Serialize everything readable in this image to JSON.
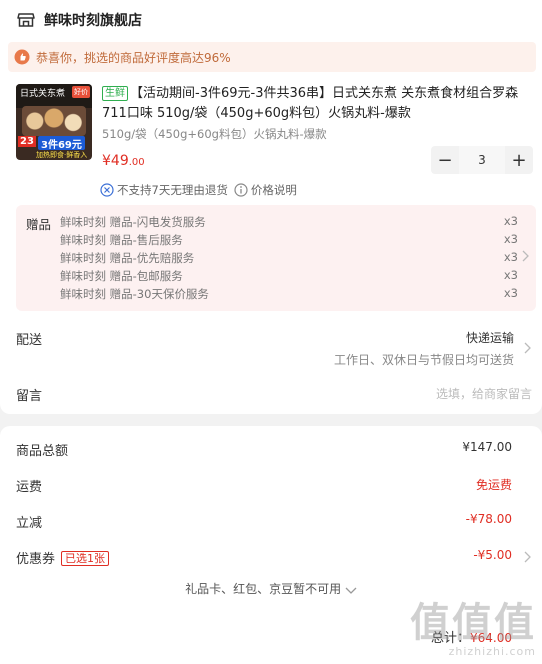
{
  "store": {
    "name": "鲜味时刻旗舰店",
    "icon": "store-icon"
  },
  "notice": {
    "icon": "thumbs-up-icon",
    "text": "恭喜你，挑选的商品好评度高达96%"
  },
  "product": {
    "thumb": {
      "top_text": "日式关东煮",
      "tag": "好价",
      "count": "23",
      "promo": "3件69元",
      "sub": "加热即食·鲜香入味"
    },
    "fresh_tag": "生鲜",
    "title": "【活动期间-3件69元-3件共36串】日式关东煮 关东煮食材组合罗森711口味 510g/袋（450g+60g料包）火锅丸料-爆款",
    "spec": "510g/袋（450g+60g料包）火锅丸料-爆款",
    "price_main": "¥49",
    "price_cents": ".00",
    "quantity": "3",
    "minus": "−",
    "plus": "+",
    "no_return": "不支持7天无理由退货",
    "price_note": "价格说明"
  },
  "gifts": {
    "label": "赠品",
    "items": [
      {
        "text": "鲜味时刻 赠品-闪电发货服务",
        "qty": "x3"
      },
      {
        "text": "鲜味时刻 赠品-售后服务",
        "qty": "x3"
      },
      {
        "text": "鲜味时刻 赠品-优先赔服务",
        "qty": "x3"
      },
      {
        "text": "鲜味时刻 赠品-包邮服务",
        "qty": "x3"
      },
      {
        "text": "鲜味时刻 赠品-30天保价服务",
        "qty": "x3"
      }
    ]
  },
  "delivery": {
    "label": "配送",
    "method": "快递运输",
    "time": "工作日、双休日与节假日均可送货"
  },
  "message": {
    "label": "留言",
    "placeholder": "选填，给商家留言"
  },
  "summary": {
    "goods_total_label": "商品总额",
    "goods_total": "¥147.00",
    "shipping_label": "运费",
    "shipping": "免运费",
    "discount_label": "立减",
    "discount": "-¥78.00",
    "coupon_label": "优惠券",
    "coupon_badge": "已选1张",
    "coupon": "-¥5.00",
    "note": "礼品卡、红包、京豆暂不可用",
    "total_label": "总计：",
    "total": "¥64.00"
  },
  "watermark": {
    "logo": "值值值",
    "url": "zhizhizhi.com"
  },
  "colors": {
    "accent": "#e02e24",
    "fresh": "#2fae4f",
    "notice_bg": "#fdf1ec",
    "gift_bg": "#fdf1f1"
  }
}
